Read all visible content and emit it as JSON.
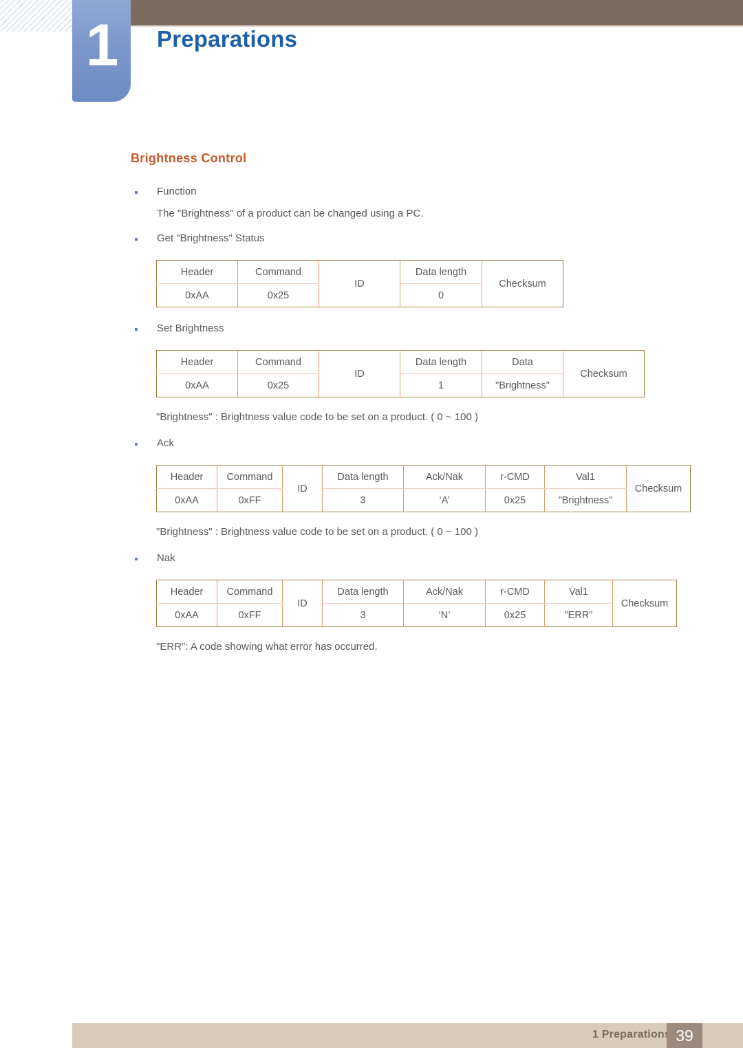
{
  "header": {
    "chapter_number": "1",
    "chapter_title": "Preparations"
  },
  "section": {
    "title": "Brightness  Control"
  },
  "bullets": {
    "function": "Function",
    "function_desc": "The \"Brightness\" of a product can be changed using a PC.",
    "get_status": "Get \"Brightness\" Status",
    "set_brightness": "Set Brightness",
    "ack": "Ack",
    "nak": "Nak"
  },
  "notes": {
    "brightness_note_1": "\"Brightness\" : Brightness value code to be set on a product. ( 0 ~ 100 )",
    "brightness_note_2": "\"Brightness\" : Brightness value code to be set on a product. ( 0 ~ 100 )",
    "err_note": "\"ERR\": A code showing what error has occurred."
  },
  "tables": {
    "get_status": {
      "headers": [
        "Header",
        "Command",
        "ID",
        "Data length",
        "Checksum"
      ],
      "values": [
        "0xAA",
        "0x25",
        "ID",
        "0",
        "Checksum"
      ],
      "merged": [
        false,
        false,
        true,
        false,
        true
      ]
    },
    "set_brightness": {
      "headers": [
        "Header",
        "Command",
        "ID",
        "Data length",
        "Data",
        "Checksum"
      ],
      "values": [
        "0xAA",
        "0x25",
        "ID",
        "1",
        "\"Brightness\"",
        "Checksum"
      ],
      "merged": [
        false,
        false,
        true,
        false,
        false,
        true
      ]
    },
    "ack": {
      "headers": [
        "Header",
        "Command",
        "ID",
        "Data length",
        "Ack/Nak",
        "r-CMD",
        "Val1",
        "Checksum"
      ],
      "values": [
        "0xAA",
        "0xFF",
        "ID",
        "3",
        "‘A’",
        "0x25",
        "\"Brightness\"",
        "Checksum"
      ],
      "merged": [
        false,
        false,
        true,
        false,
        false,
        false,
        false,
        true
      ]
    },
    "nak": {
      "headers": [
        "Header",
        "Command",
        "ID",
        "Data length",
        "Ack/Nak",
        "r-CMD",
        "Val1",
        "Checksum"
      ],
      "values": [
        "0xAA",
        "0xFF",
        "ID",
        "3",
        "‘N’",
        "0x25",
        "\"ERR\"",
        "Checksum"
      ],
      "merged": [
        false,
        false,
        true,
        false,
        false,
        false,
        false,
        true
      ]
    }
  },
  "footer": {
    "label": "1 Preparations",
    "page_number": "39"
  },
  "colors": {
    "chapter_title": "#1f5fa9",
    "section_title": "#c8592a",
    "header_bar": "#7b6c5e",
    "chapter_block": "#7c97cb",
    "table_outer_border": "#a08244",
    "table_inner_border": "#e09a6e",
    "footer_bar": "#d7cbba",
    "footer_page_box": "#9d8a7d"
  }
}
